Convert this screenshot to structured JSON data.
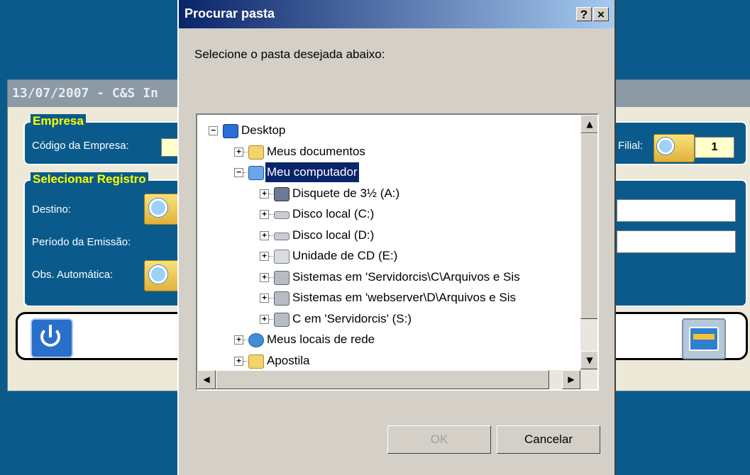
{
  "background_app": {
    "title": "13/07/2007 - C&S In",
    "empresa": {
      "group_label": "Empresa",
      "codigo_label": "Código da Empresa:",
      "filial_label": "Filial:",
      "filial_value": "1"
    },
    "selecionar": {
      "group_label": "Selecionar Registro",
      "destino_label": "Destino:",
      "periodo_label": "Período da Emissão:",
      "obs_label": "Obs. Automática:"
    }
  },
  "dialog": {
    "title": "Procurar pasta",
    "help_button": "?",
    "close_button": "×",
    "prompt": "Selecione o pasta desejada abaixo:",
    "tree": [
      {
        "label": "Desktop",
        "icon": "desktop-icon",
        "expander": "−"
      },
      {
        "label": "Meus documentos",
        "icon": "documents-folder-icon",
        "expander": "+"
      },
      {
        "label": "Meu computador",
        "icon": "computer-icon",
        "expander": "−",
        "selected": true
      },
      {
        "label": "Disquete de 3½ (A:)",
        "icon": "floppy-drive-icon",
        "expander": "+"
      },
      {
        "label": "Disco local (C:)",
        "icon": "hard-disk-icon",
        "expander": "+"
      },
      {
        "label": "Disco local (D:)",
        "icon": "hard-disk-icon",
        "expander": "+"
      },
      {
        "label": "Unidade de CD (E:)",
        "icon": "cd-drive-icon",
        "expander": "+"
      },
      {
        "label": "Sistemas em 'Servidorcis\\C\\Arquivos e Sis",
        "icon": "network-drive-icon",
        "expander": "+"
      },
      {
        "label": "Sistemas em 'webserver\\D\\Arquivos e Sis",
        "icon": "network-drive-icon",
        "expander": "+"
      },
      {
        "label": "C em 'Servidorcis' (S:)",
        "icon": "network-drive-icon",
        "expander": "+"
      },
      {
        "label": "Meus locais de rede",
        "icon": "network-places-icon",
        "expander": "+"
      },
      {
        "label": "Apostila",
        "icon": "folder-icon",
        "expander": "+"
      }
    ],
    "ok_button": "OK",
    "cancel_button": "Cancelar"
  },
  "colors": {
    "desktop_bg": "#0a5b8c",
    "dialog_bg": "#d4d0c8",
    "title_bar": "#0a246a",
    "selection": "#0a246a",
    "group_label": "#ffff00"
  }
}
